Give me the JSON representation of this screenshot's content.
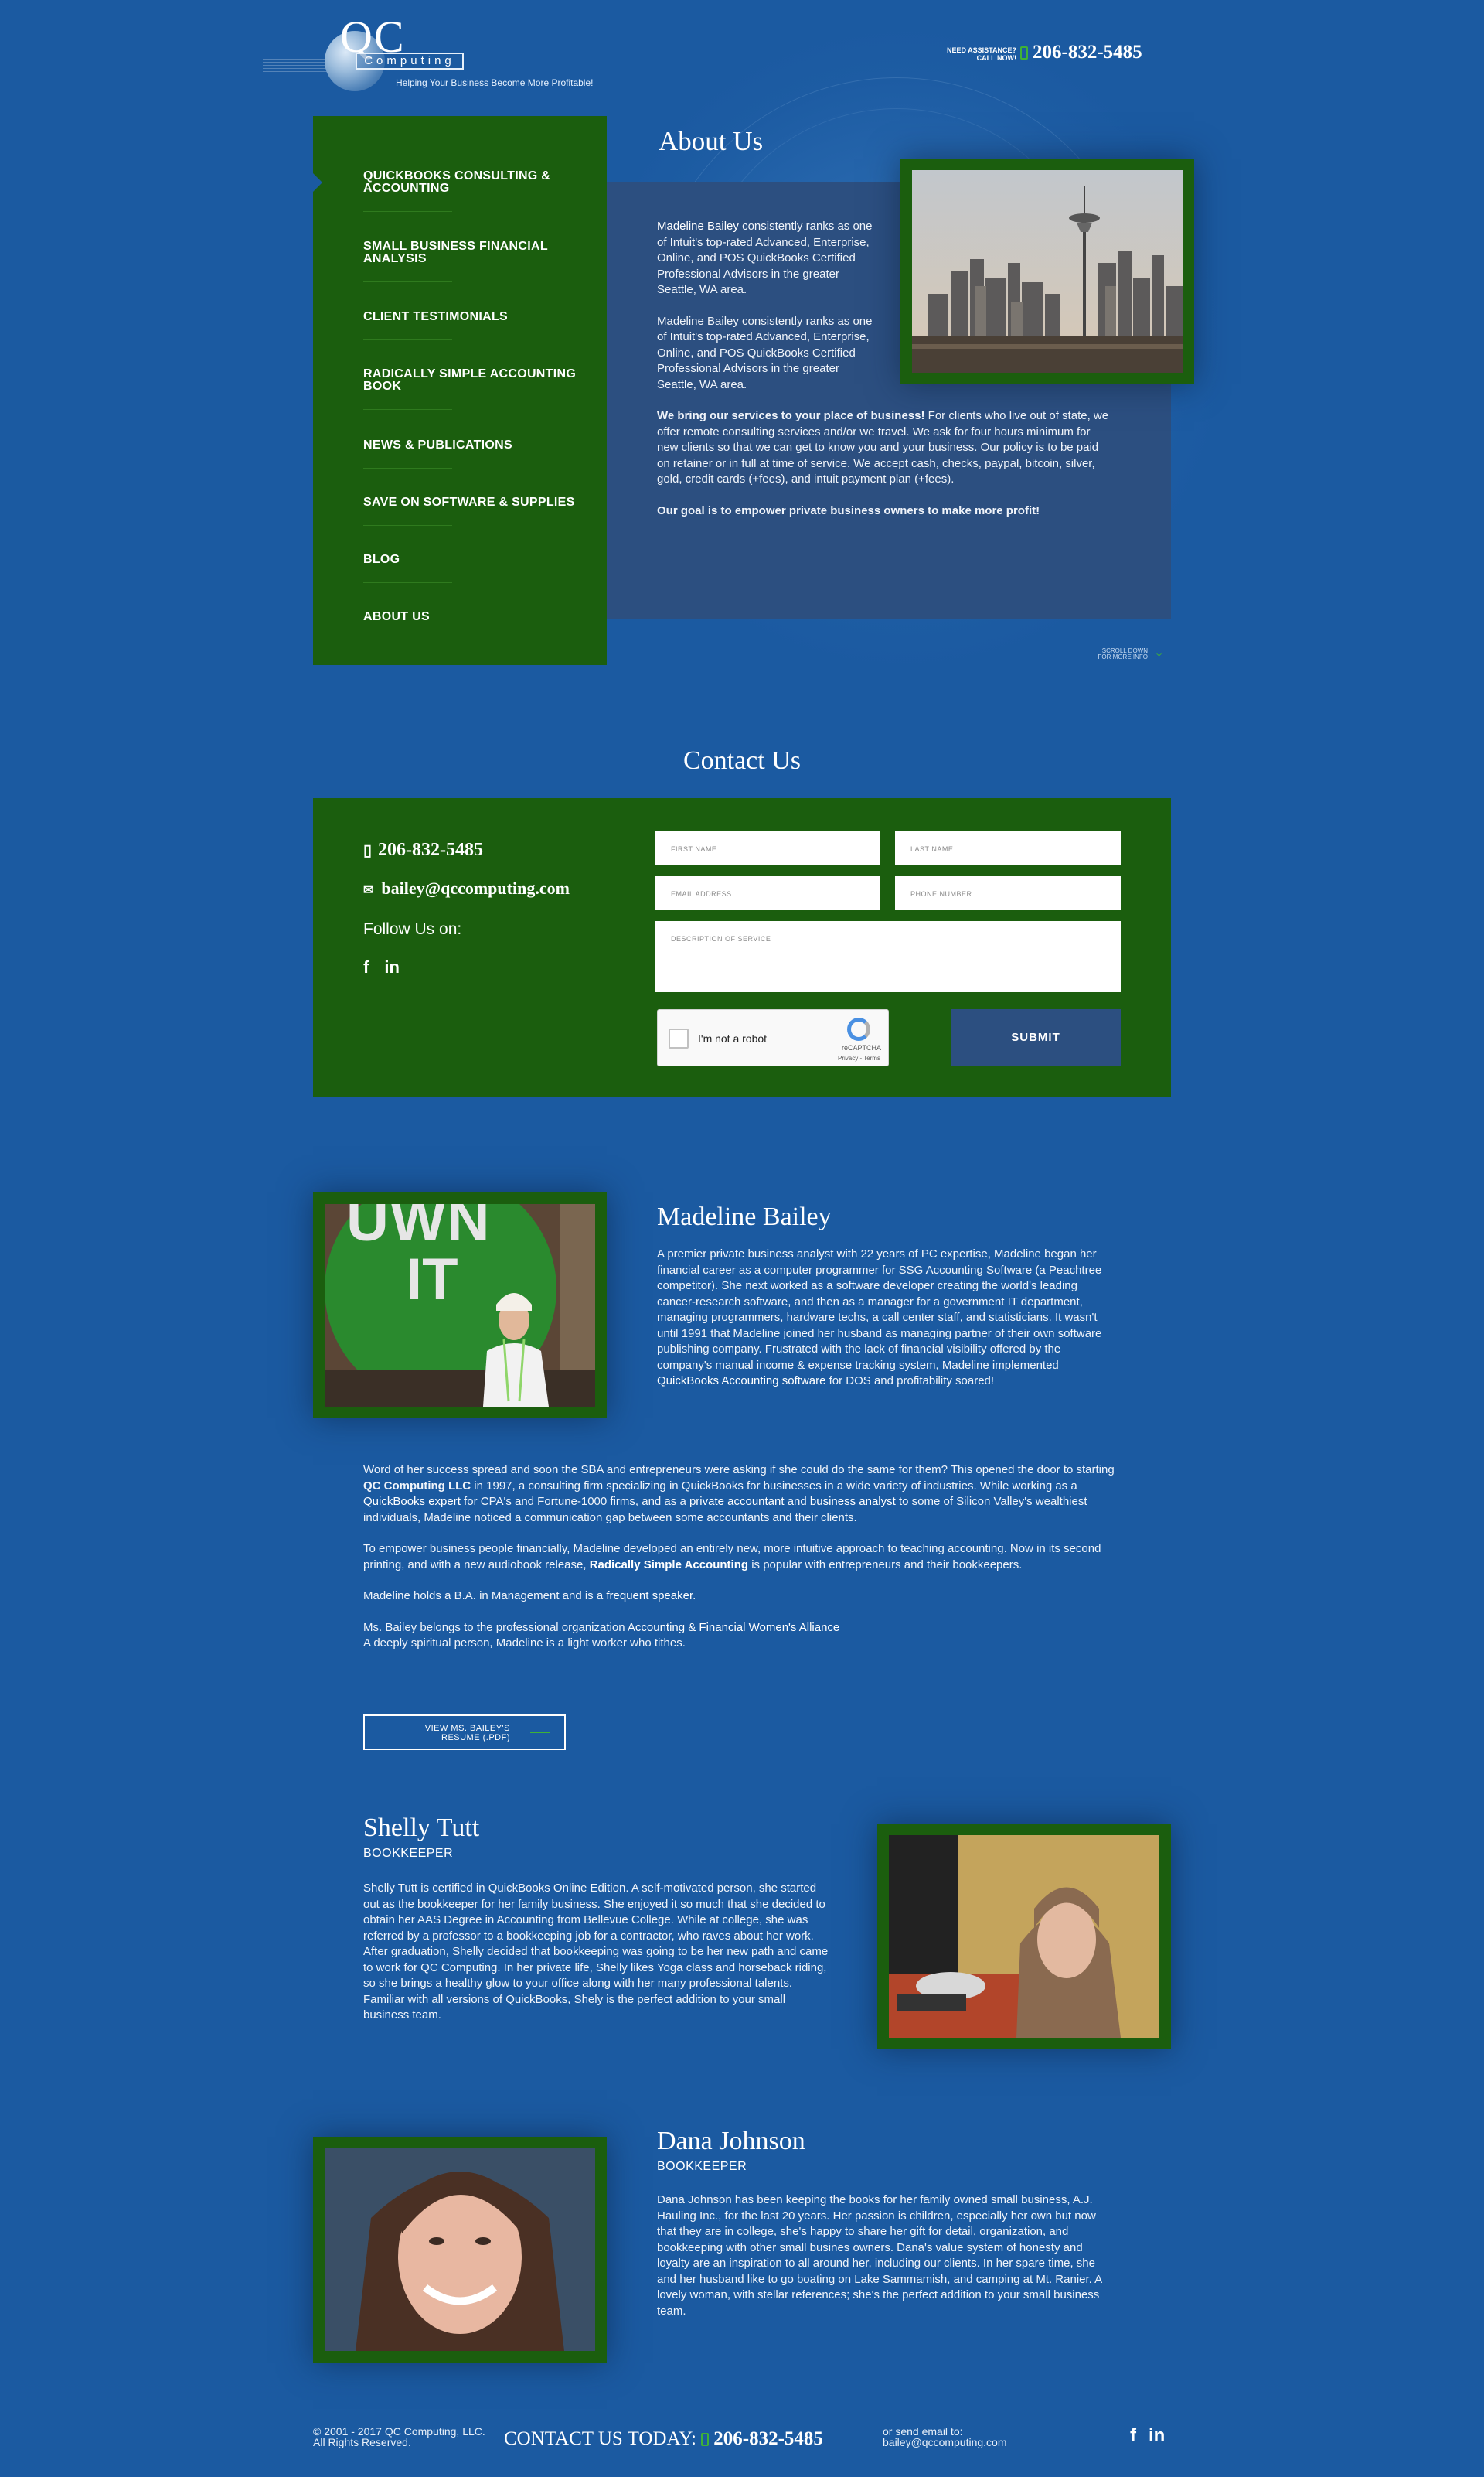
{
  "header": {
    "logo_qc": "QC",
    "logo_computing": "Computing",
    "tagline": "Helping Your Business Become More Profitable!",
    "assist_line1": "NEED ASSISTANCE?",
    "assist_line2": "CALL NOW!",
    "phone": "206-832-5485"
  },
  "nav": {
    "items": [
      {
        "label": "QUICKBOOKS CONSULTING & ACCOUNTING"
      },
      {
        "label": "SMALL BUSINESS FINANCIAL ANALYSIS"
      },
      {
        "label": "CLIENT TESTIMONIALS"
      },
      {
        "label": "RADICALLY SIMPLE ACCOUNTING BOOK"
      },
      {
        "label": "NEWS & PUBLICATIONS"
      },
      {
        "label": "SAVE ON SOFTWARE & SUPPLIES"
      },
      {
        "label": "BLOG"
      },
      {
        "label": "ABOUT US"
      }
    ]
  },
  "about": {
    "title": "About Us",
    "p1_link": "Madeline Bailey",
    "p1_rest": " consistently ranks as one of Intuit's top-rated Advanced, Enterprise, Online, and POS QuickBooks Certified Professional Advisors in the greater Seattle, WA area.",
    "p2": "Madeline Bailey consistently ranks as one of Intuit's top-rated Advanced, Enterprise, Online, and POS QuickBooks Certified Professional Advisors in the greater Seattle, WA area.",
    "p3_bold": "We bring our services to your place of business!",
    "p3_rest": " For clients who live out of state, we offer remote consulting services and/or we travel. We ask for four hours minimum for new clients so that we can get to know you and your business. Our policy is to be paid on retainer or in full at time of service. We accept cash, checks, paypal, bitcoin, silver, gold, credit cards (+fees), and intuit payment plan (+fees).",
    "p4_bold": "Our goal is to empower private business owners to make more profit!",
    "scroll_line1": "SCROLL DOWN",
    "scroll_line2": "FOR MORE INFO"
  },
  "contact": {
    "title": "Contact Us",
    "phone": "206-832-5485",
    "email": "bailey@qccomputing.com",
    "follow": "Follow Us on:",
    "form": {
      "first_name": "FIRST NAME",
      "last_name": "LAST NAME",
      "email": "EMAIL ADDRESS",
      "phone": "PHONE NUMBER",
      "description": "DESCRIPTION OF SERVICE",
      "captcha_label": "I'm not a robot",
      "captcha_brand": "reCAPTCHA",
      "captcha_terms": "Privacy - Terms",
      "submit": "SUBMIT"
    }
  },
  "madeline": {
    "name": "Madeline Bailey",
    "photo_text1": "UWN",
    "photo_text2": "IT",
    "p1_a": "A premier private business analyst with 22 years of PC expertise, Madeline began her financial career as a computer programmer for SSG Accounting Software (a Peachtree competitor). She next worked as a software developer creating the world's leading cancer-research software, and then as a manager for a government IT department, managing programmers, hardware techs, a call center staff, and statisticians. It wasn't until 1991 that Madeline joined her husband as managing partner of their own software publishing company. Frustrated with the lack of financial visibility offered by the company's manual income & expense tracking system, Madeline implemented ",
    "p1_link": "QuickBooks Accounting software",
    "p1_b": " for DOS and profitability soared!",
    "p2_a": "Word of her success spread and soon the SBA and entrepreneurs were asking if she could do the same for them? This opened the door to starting ",
    "p2_bold": "QC Computing LLC",
    "p2_b": " in 1997, a consulting firm specializing in QuickBooks for businesses in a wide variety of industries. While working as a ",
    "p2_link1": "QuickBooks expert",
    "p2_c": " for CPA's and Fortune-1000 firms, and as a ",
    "p2_link2": "private accountant",
    "p2_d": " and ",
    "p2_link3": "business analyst",
    "p2_e": " to some of Silicon Valley's wealthiest individuals, Madeline noticed a communication gap between some accountants and their clients.",
    "p3_a": "To empower business people financially, Madeline developed an entirely new, more intuitive approach to teaching accounting. Now in its second printing, and with a new audiobook release, ",
    "p3_link": "Radically Simple Accounting",
    "p3_b": " is popular with entrepreneurs and their bookkeepers.",
    "p4_a": "Madeline holds a B.A. in Management and is a ",
    "p4_link": "frequent speaker",
    "p4_b": ".",
    "p5_a": "Ms. Bailey belongs to the professional organization ",
    "p5_link": "Accounting & Financial Women's Alliance",
    "p5_b": "A deeply spiritual person, Madeline is a light worker who tithes.",
    "resume_line1": "VIEW MS. BAILEY'S",
    "resume_line2": "RESUME (.PDF)"
  },
  "shelly": {
    "name": "Shelly Tutt",
    "role": "BOOKKEEPER",
    "text": "Shelly Tutt is certified in QuickBooks Online Edition. A self-motivated person, she started out as the bookkeeper for her family business. She enjoyed it so much that she decided to obtain her AAS Degree in Accounting from Bellevue College. While at college, she was referred by a professor to a bookkeeping job for a contractor, who raves about her work. After graduation, Shelly decided that bookkeeping was going to be her new path and came to work for QC Computing. In her private life, Shelly likes Yoga class and horseback riding, so she brings a healthy glow to your office along with her many professional talents. Familiar with all versions of QuickBooks, Shely is the perfect addition to your small business team."
  },
  "dana": {
    "name": "Dana Johnson",
    "role": "BOOKKEEPER",
    "text": "Dana Johnson has been keeping the books for her family owned small business, A.J. Hauling Inc., for the last 20 years. Her passion is children, especially her own but now that they are in college, she's happy to share her gift for detail, organization, and bookkeeping with other small busines owners. Dana's value system of honesty and loyalty are an inspiration to all around her, including our clients. In her spare time, she and her husband like to go boating on Lake Sammamish, and camping at Mt. Ranier. A lovely woman, with stellar references; she's the perfect addition to your small business team."
  },
  "footer": {
    "copy1": "© 2001 - 2017 QC Computing, LLC.",
    "copy2": "All Rights Reserved.",
    "contact_label": "CONTACT US TODAY:",
    "phone": "206-832-5485",
    "email_label": "or send email to:",
    "email": "bailey@qccomputing.com"
  },
  "colors": {
    "background": "#1b5aa1",
    "green": "#1b5e0e",
    "panel": "#2c4f80",
    "accent": "#3fb236"
  }
}
